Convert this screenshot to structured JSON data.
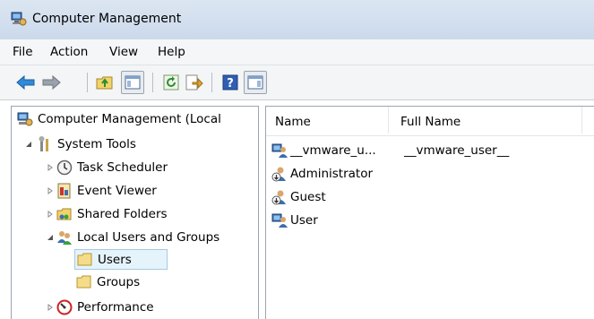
{
  "window": {
    "title": "Computer Management"
  },
  "menu": [
    "File",
    "Action",
    "View",
    "Help"
  ],
  "toolbar": {
    "icons": [
      "back-icon",
      "forward-icon",
      "up-folder-icon",
      "show-hide-console-tree-icon",
      "refresh-icon",
      "export-list-icon",
      "help-icon",
      "show-hide-action-pane-icon"
    ]
  },
  "tree": {
    "root": "Computer Management (Local",
    "system_tools": "System Tools",
    "task_scheduler": "Task Scheduler",
    "event_viewer": "Event Viewer",
    "shared_folders": "Shared Folders",
    "local_users": "Local Users and Groups",
    "users": "Users",
    "groups": "Groups",
    "performance": "Performance"
  },
  "list": {
    "columns": [
      "Name",
      "Full Name"
    ],
    "rows": [
      {
        "name": "__vmware_u...",
        "full_name": "__vmware_user__"
      },
      {
        "name": "Administrator",
        "full_name": ""
      },
      {
        "name": "Guest",
        "full_name": ""
      },
      {
        "name": "User",
        "full_name": ""
      }
    ]
  },
  "colors": {
    "titlebar": "#dce6f2",
    "selection": "#e5f3fb",
    "border": "#9aa5b4"
  }
}
